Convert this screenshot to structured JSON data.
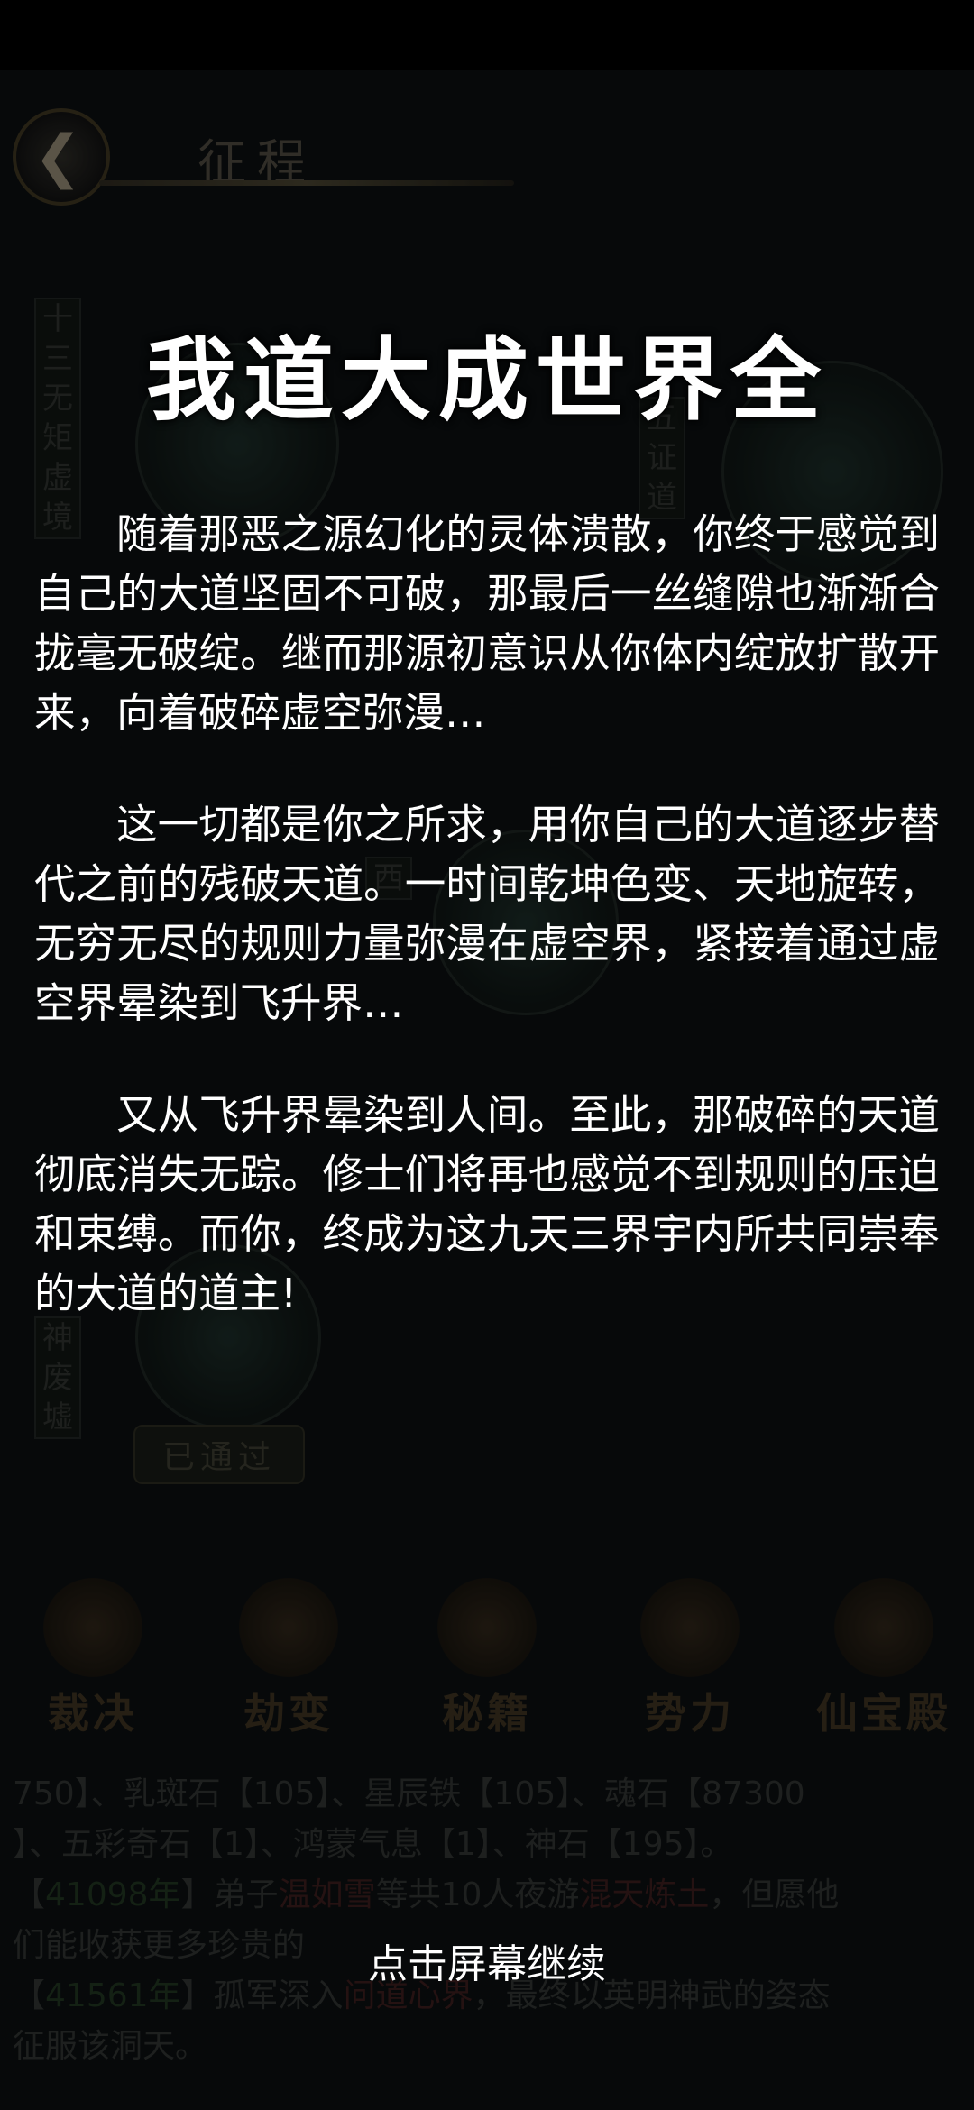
{
  "background": {
    "top_title": "征程",
    "back_icon": "chevron-left-icon",
    "node_labels": [
      "十三无矩虚境",
      "五证道",
      "西",
      "神废墟"
    ],
    "passed_badge": "已通过",
    "nav": [
      "裁决",
      "劫变",
      "秘籍",
      "势力",
      "仙宝殿"
    ],
    "log_lines": [
      [
        "750】、乳斑石【105】、星辰铁【105】、魂石【87300"
      ],
      [
        "】、五彩奇石【1】、鸿蒙气息【1】、神石【195】。"
      ],
      [
        "【",
        "41098年",
        "】弟子",
        "温如雪",
        "等共10人夜游",
        "混天炼土",
        "，但愿他"
      ],
      [
        "们能收获更多珍贵的"
      ],
      [
        "【",
        "41561年",
        "】孤军深入",
        "问道心界",
        "，最终以英明神武的姿态"
      ],
      [
        "征服该洞天。"
      ]
    ]
  },
  "dialog": {
    "title": "我道大成世界全",
    "paragraphs": [
      "随着那恶之源幻化的灵体溃散，你终于感觉到自己的大道坚固不可破，那最后一丝缝隙也渐渐合拢毫无破绽。继而那源初意识从你体内绽放扩散开来，向着破碎虚空弥漫…",
      "这一切都是你之所求，用你自己的大道逐步替代之前的残破天道。一时间乾坤色变、天地旋转，无穷无尽的规则力量弥漫在虚空界，紧接着通过虚空界晕染到飞升界…",
      "又从飞升界晕染到人间。至此，那破碎的天道彻底消失无踪。修士们将再也感觉不到规则的压迫和束缚。而你，终成为这九天三界宇内所共同崇奉的大道的道主!"
    ],
    "continue_hint": "点击屏幕继续"
  }
}
